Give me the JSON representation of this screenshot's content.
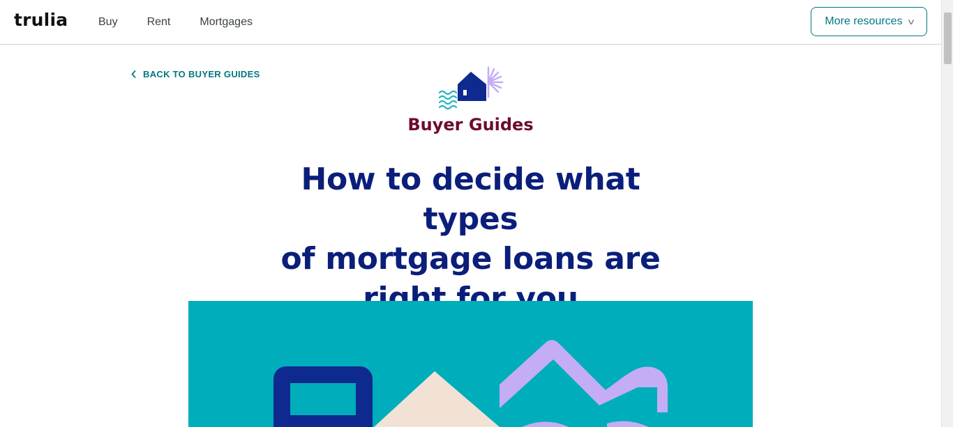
{
  "header": {
    "logo": "trulia",
    "nav": [
      "Buy",
      "Rent",
      "Mortgages"
    ],
    "more_resources_label": "More resources"
  },
  "back_link": {
    "label": "BACK TO BUYER GUIDES"
  },
  "category": {
    "label": "Buyer Guides",
    "icon": "house-with-sun-and-waves-icon"
  },
  "article": {
    "title_lines": [
      "How to decide what types",
      "of mortgage loans are",
      "right for you"
    ]
  },
  "hero": {
    "illustration": "calculator-house-abstract-illustration"
  },
  "colors": {
    "brand_teal": "#007882",
    "title_navy": "#0a1e7a",
    "category_maroon": "#6d0a31",
    "hero_background": "#00adbb",
    "hero_navy": "#0e2a8f",
    "hero_lavender": "#c4adf5",
    "hero_peach": "#f2e2d5"
  }
}
